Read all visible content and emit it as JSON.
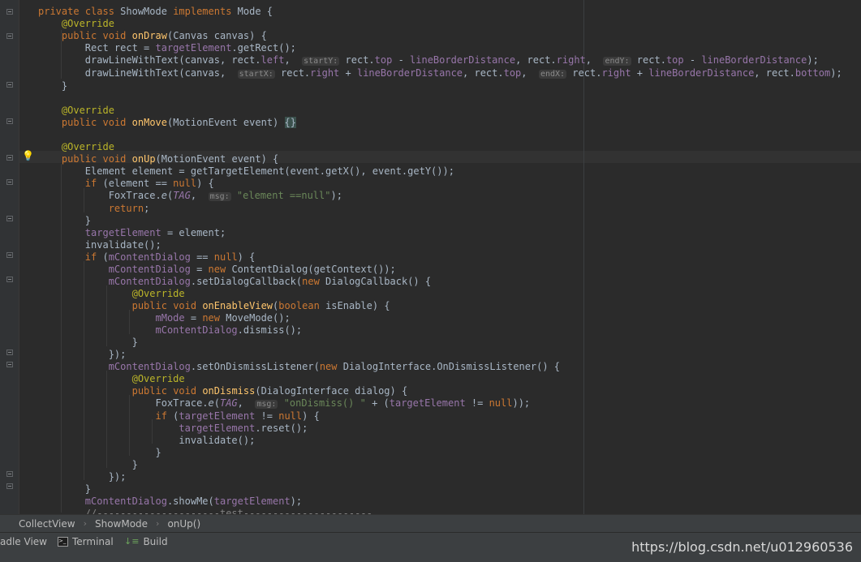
{
  "editor": {
    "lines": [
      "private class ShowMode implements Mode {",
      "    @Override",
      "    public void onDraw(Canvas canvas) {",
      "        Rect rect = targetElement.getRect();",
      "        drawLineWithText(canvas, rect.left,  startY: rect.top - lineBorderDistance, rect.right,  endY: rect.top - lineBorderDistance);",
      "        drawLineWithText(canvas,  startX: rect.right + lineBorderDistance, rect.top,  endX: rect.right + lineBorderDistance, rect.bottom);",
      "    }",
      "",
      "    @Override",
      "    public void onMove(MotionEvent event) {}",
      "",
      "    @Override",
      "    public void onUp(MotionEvent event) {",
      "        Element element = getTargetElement(event.getX(), event.getY());",
      "        if (element == null) {",
      "            FoxTrace.e(TAG,  msg: \"element ==null\");",
      "            return;",
      "        }",
      "        targetElement = element;",
      "        invalidate();",
      "        if (mContentDialog == null) {",
      "            mContentDialog = new ContentDialog(getContext());",
      "            mContentDialog.setDialogCallback(new DialogCallback() {",
      "                @Override",
      "                public void onEnableView(boolean isEnable) {",
      "                    mMode = new MoveMode();",
      "                    mContentDialog.dismiss();",
      "                }",
      "            });",
      "            mContentDialog.setOnDismissListener(new DialogInterface.OnDismissListener() {",
      "                @Override",
      "                public void onDismiss(DialogInterface dialog) {",
      "                    FoxTrace.e(TAG,  msg: \"onDismiss() \" + (targetElement != null));",
      "                    if (targetElement != null) {",
      "                        targetElement.reset();",
      "                        invalidate();",
      "                    }",
      "                }",
      "            });",
      "        }",
      "        mContentDialog.showMe(targetElement);",
      "        //---------------------test----------------------"
    ]
  },
  "breadcrumb": [
    "CollectView",
    "ShowMode",
    "onUp()"
  ],
  "toolbar": {
    "gradle_label": "adle View",
    "terminal_label": "Terminal",
    "build_label": "Build"
  },
  "watermark": "https://blog.csdn.net/u012960536",
  "icons": {
    "bulb": "lightbulb-icon",
    "terminal": "terminal-icon",
    "build": "build-icon",
    "fold": "fold-marker-icon"
  },
  "colors": {
    "background": "#2b2b2b",
    "keyword": "#cc7832",
    "annotation": "#bbb529",
    "method": "#ffc66d",
    "field": "#9876aa",
    "string": "#6a8759",
    "text": "#a9b7c6"
  }
}
